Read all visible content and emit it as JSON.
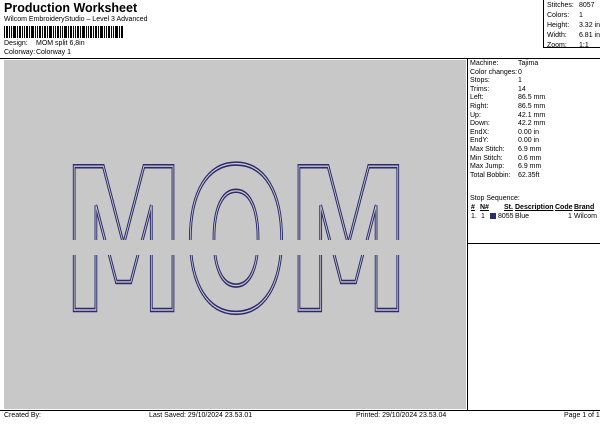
{
  "header": {
    "title": "Production Worksheet",
    "subtitle": "Wilcom EmbroideryStudio – Level 3 Advanced",
    "design_label": "Design:",
    "design_value": "MOM split 6,8in",
    "colorway_label": "Colorway:",
    "colorway_value": "Colorway 1"
  },
  "summary": {
    "stitches_label": "Stitches:",
    "stitches_value": "8057",
    "colors_label": "Colors:",
    "colors_value": "1",
    "height_label": "Height:",
    "height_value": "3.32 in",
    "width_label": "Width:",
    "width_value": "6.81 in",
    "zoom_label": "Zoom:",
    "zoom_value": "1:1"
  },
  "specs": [
    {
      "label": "Machine:",
      "value": "Tajima"
    },
    {
      "label": "Color changes:",
      "value": "0"
    },
    {
      "label": "Stops:",
      "value": "1"
    },
    {
      "label": "Trims:",
      "value": "14"
    },
    {
      "label": "Left:",
      "value": "86.5 mm"
    },
    {
      "label": "Right:",
      "value": "86.5 mm"
    },
    {
      "label": "Up:",
      "value": "42.1 mm"
    },
    {
      "label": "Down:",
      "value": "42.2 mm"
    },
    {
      "label": "EndX:",
      "value": "0.00 in"
    },
    {
      "label": "EndY:",
      "value": "0.00 in"
    },
    {
      "label": "Max Stitch:",
      "value": "6.9 mm"
    },
    {
      "label": "Min Stitch:",
      "value": "0.6 mm"
    },
    {
      "label": "Max Jump:",
      "value": "6.9 mm"
    },
    {
      "label": "Total Bobbin:",
      "value": "62.35ft"
    }
  ],
  "stop_sequence": {
    "title": "Stop Sequence:",
    "headers": {
      "num": "#",
      "n": "N#",
      "st": "St.",
      "desc": "Description",
      "code": "Code",
      "brand": "Brand"
    },
    "rows": [
      {
        "num": "1.",
        "n": "1",
        "st": "8055",
        "desc": "Blue",
        "code": "1",
        "brand": "Wilcom",
        "color": "#2b2a6e"
      }
    ]
  },
  "design_text": {
    "top": "MOM",
    "bottom": "MOM"
  },
  "colors": {
    "thread": "#2b2a6e",
    "canvas": "#c8c8c8"
  },
  "footer": {
    "created_by": "Created By:",
    "last_saved": "Last Saved: 29/10/2024 23.53.01",
    "printed": "Printed: 29/10/2024 23.53.04",
    "page": "Page 1 of 1"
  }
}
